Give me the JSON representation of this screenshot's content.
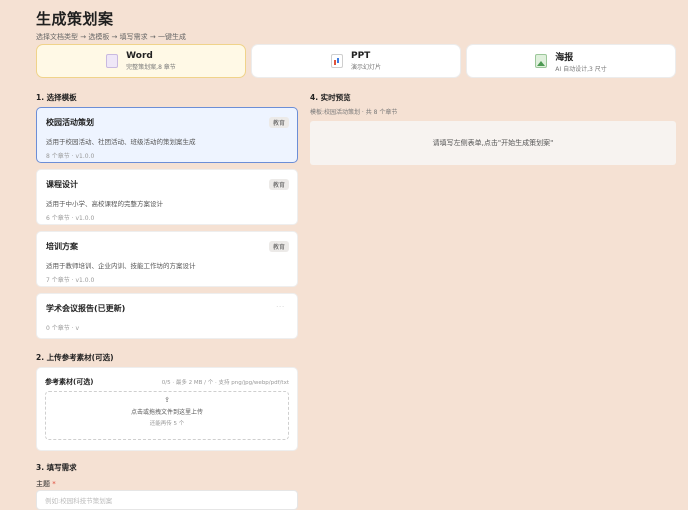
{
  "header": {
    "title": "生成策划案",
    "subtitle": "选择文档类型 → 选模板 → 填写需求 → 一键生成"
  },
  "doc_types": [
    {
      "name": "Word",
      "desc": "完整策划案,8 章节",
      "icon": "word-doc-icon"
    },
    {
      "name": "PPT",
      "desc": "演示幻灯片",
      "icon": "ppt-chart-icon"
    },
    {
      "name": "海报",
      "desc": "AI 自动设计,3 尺寸",
      "icon": "poster-image-icon"
    }
  ],
  "sections": {
    "templates": "1. 选择模板",
    "upload": "2. 上传参考素材(可选)",
    "requirements": "3. 填写需求",
    "preview": "4. 实时预览"
  },
  "templates": [
    {
      "name": "校园活动策划",
      "tag": "教育",
      "desc": "适用于校园活动、社团活动、班级活动的策划案生成",
      "meta": "8 个章节 · v1.0.0"
    },
    {
      "name": "课程设计",
      "tag": "教育",
      "desc": "适用于中小学、高校课程的完整方案设计",
      "meta": "6 个章节 · v1.0.0"
    },
    {
      "name": "培训方案",
      "tag": "教育",
      "desc": "适用于教师培训、企业内训、技能工作坊的方案设计",
      "meta": "7 个章节 · v1.0.0"
    },
    {
      "name": "学术会议报告(已更新)",
      "tag": "···",
      "desc": "",
      "meta": "0 个章节 · v"
    }
  ],
  "upload": {
    "label": "参考素材(可选)",
    "limit": "0/5 · 最多 2 MB / 个 · 支持 png/jpg/webp/pdf/txt",
    "icon": "⇪",
    "drop_text": "点击或拖拽文件到这里上传",
    "remaining": "还能再传 5 个"
  },
  "requirements": {
    "topic_label": "主题",
    "required_mark": "*",
    "topic_placeholder": "例如:校园科技节策划案"
  },
  "preview": {
    "subtitle": "模板:校园活动策划 · 共 8 个章节",
    "empty_text": "请填写左侧表单,点击\"开始生成策划案\""
  }
}
